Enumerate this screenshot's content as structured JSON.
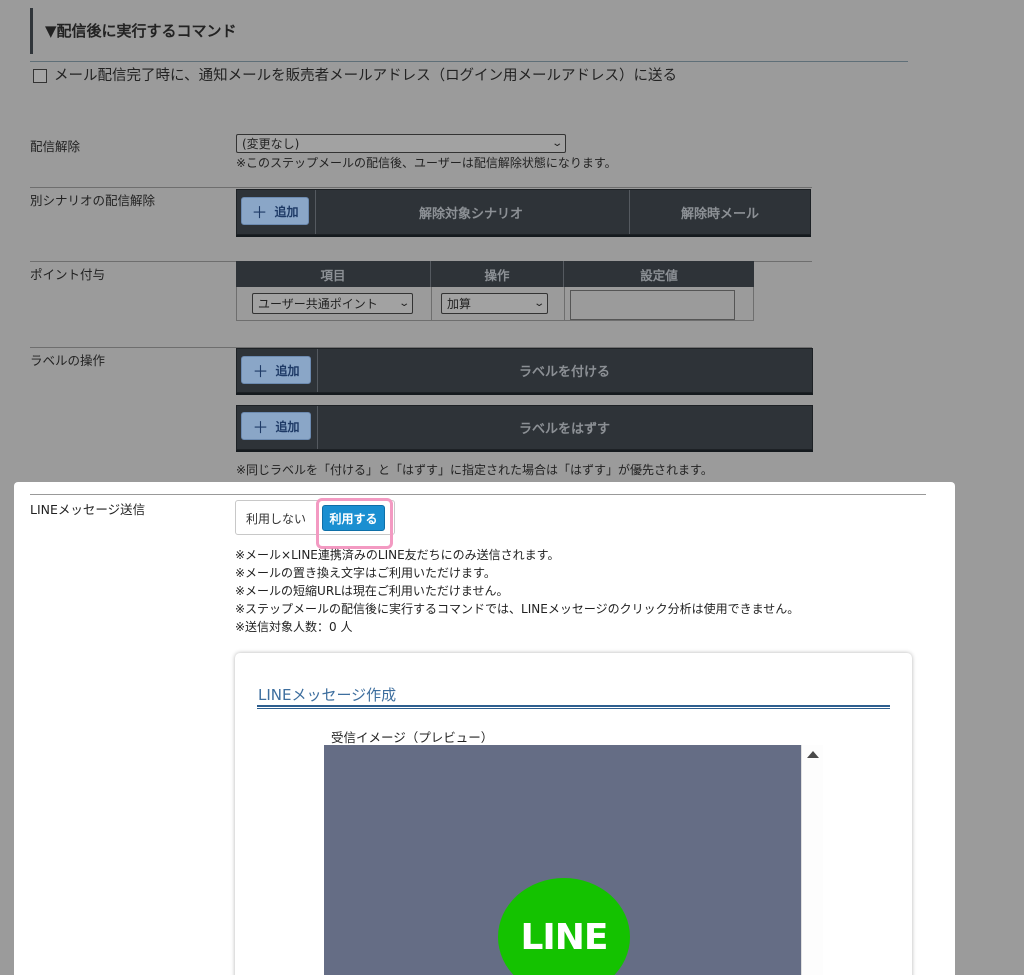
{
  "section": {
    "title": "▼配信後に実行するコマンド",
    "notify_label": "メール配信完了時に、通知メールを販売者メールアドレス（ログイン用メールアドレス）に送る"
  },
  "unsubscribe": {
    "label": "配信解除",
    "select_value": "(変更なし)",
    "note": "※このステップメールの配信後、ユーザーは配信解除状態になります。"
  },
  "other_scenario": {
    "label": "別シナリオの配信解除",
    "add_label": "追加",
    "col_target": "解除対象シナリオ",
    "col_mail": "解除時メール"
  },
  "points": {
    "label": "ポイント付与",
    "headers": [
      "項目",
      "操作",
      "設定値"
    ],
    "item_value": "ユーザー共通ポイント",
    "op_value": "加算",
    "setting_value": ""
  },
  "labels": {
    "label": "ラベルの操作",
    "add_label": "追加",
    "attach": "ラベルを付ける",
    "remove": "ラベルをはずす",
    "note": "※同じラベルを「付ける」と「はずす」に指定された場合は「はずす」が優先されます。"
  },
  "line": {
    "label": "LINEメッセージ送信",
    "off_label": "利用しない",
    "on_label": "利用する",
    "notes": [
      "※メール×LINE連携済みのLINE友だちにのみ送信されます。",
      "※メールの置き換え文字はご利用いただけます。",
      "※メールの短縮URLは現在ご利用いただけません。",
      "※ステップメールの配信後に実行するコマンドでは、LINEメッセージのクリック分析は使用できません。",
      "※送信対象人数：0 人"
    ],
    "card_title": "LINEメッセージ作成",
    "preview_label": "受信イメージ（プレビュー）",
    "logo_text": "LINE"
  },
  "colors": {
    "dark_bar": "#2e3338",
    "accent_blue": "#1a8fd1",
    "highlight_pink": "#f39ac2",
    "line_green": "#14c200",
    "preview_bg": "#656d85"
  }
}
